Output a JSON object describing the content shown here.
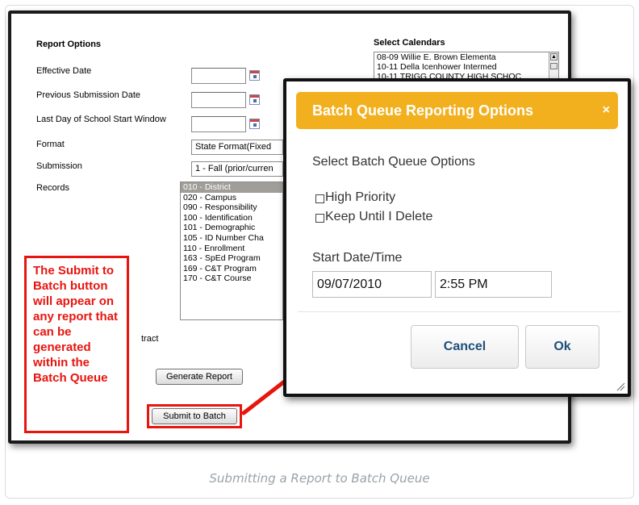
{
  "report_options": {
    "heading": "Report Options",
    "effective_date_label": "Effective Date",
    "effective_date_value": "",
    "previous_submission_label": "Previous Submission Date",
    "previous_submission_value": "",
    "last_day_label": "Last Day of School Start Window",
    "last_day_value": "",
    "format_label": "Format",
    "format_value": "State Format(Fixed",
    "submission_label": "Submission",
    "submission_value": "1 - Fall (prior/curren",
    "records_label": "Records",
    "records": [
      "010 - District",
      "020 - Campus",
      "090 - Responsibility",
      "100 - Identification",
      "101 - Demographic",
      "105 - ID Number Cha",
      "110 - Enrollment",
      "163 - SpEd Program",
      "169 - C&T Program",
      "170 - C&T Course"
    ],
    "partial_text": "tract",
    "generate_button": "Generate Report",
    "submit_batch_button": "Submit to Batch"
  },
  "select_calendars": {
    "heading": "Select Calendars",
    "items": [
      "08-09 Willie E. Brown Elementa",
      "10-11 Della Icenhower Intermed",
      "10-11 TRIGG COUNTY HIGH SCHOC"
    ]
  },
  "callout": {
    "text": "The Submit to Batch button will appear on any report that can be generated within the Batch Queue",
    "color": "#e8150f"
  },
  "modal": {
    "title": "Batch Queue Reporting Options",
    "close": "×",
    "options_label": "Select Batch Queue Options",
    "high_priority": "High Priority",
    "keep_until": "Keep Until I Delete",
    "start_label": "Start Date/Time",
    "start_date": "09/07/2010",
    "start_time": "2:55 PM",
    "cancel": "Cancel",
    "ok": "Ok",
    "header_color": "#f2b01e"
  },
  "caption": "Submitting a Report to Batch Queue"
}
